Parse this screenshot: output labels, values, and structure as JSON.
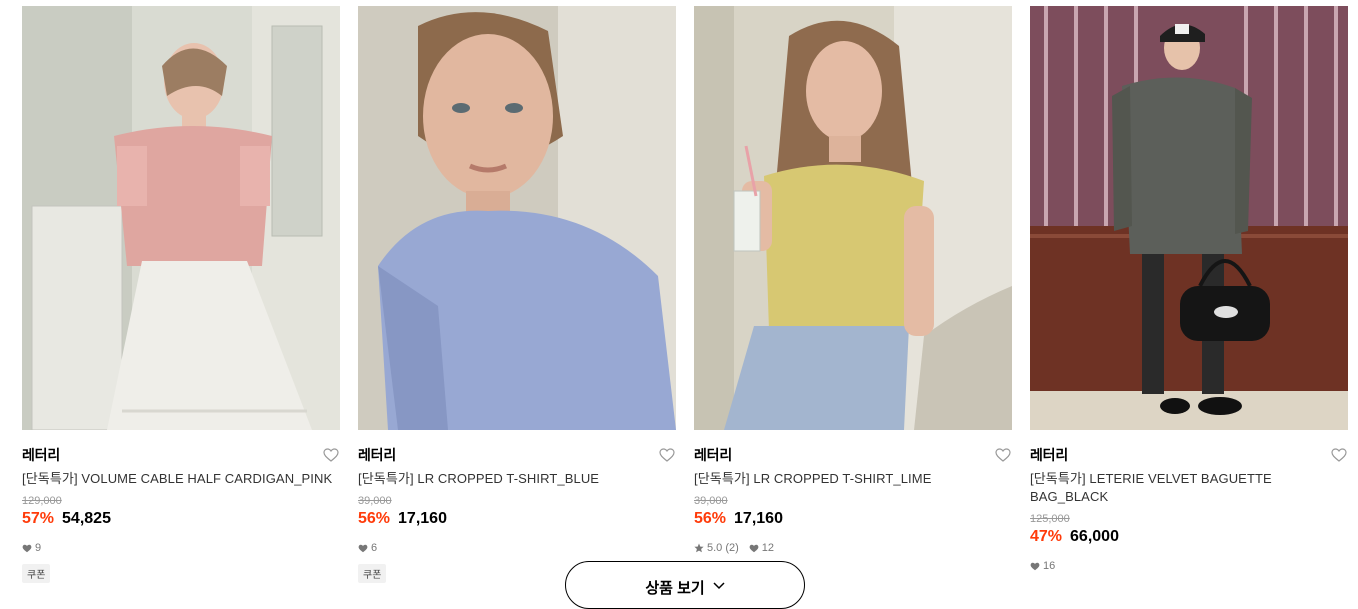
{
  "products": [
    {
      "brand": "레터리",
      "title": "[단독특가] VOLUME CABLE HALF CARDIGAN_PINK",
      "original_price": "129,000",
      "discount": "57%",
      "price": "54,825",
      "rating": null,
      "likes": "9",
      "coupon": "쿠폰"
    },
    {
      "brand": "레터리",
      "title": "[단독특가] LR CROPPED T-SHIRT_BLUE",
      "original_price": "39,000",
      "discount": "56%",
      "price": "17,160",
      "rating": null,
      "likes": "6",
      "coupon": "쿠폰"
    },
    {
      "brand": "레터리",
      "title": "[단독특가] LR CROPPED T-SHIRT_LIME",
      "original_price": "39,000",
      "discount": "56%",
      "price": "17,160",
      "rating": "5.0 (2)",
      "likes": "12",
      "coupon": null
    },
    {
      "brand": "레터리",
      "title": "[단독특가] LETERIE VELVET BAGUETTE BAG_BLACK",
      "original_price": "125,000",
      "discount": "47%",
      "price": "66,000",
      "rating": null,
      "likes": "16",
      "coupon": null
    }
  ],
  "more_button": {
    "label": "상품 보기"
  },
  "icons": {
    "wishlist": "heart-outline-icon",
    "like": "heart-filled-icon",
    "rating": "star-icon",
    "more": "chevron-down-icon"
  },
  "colors": {
    "discount": "#ff3b0a"
  }
}
